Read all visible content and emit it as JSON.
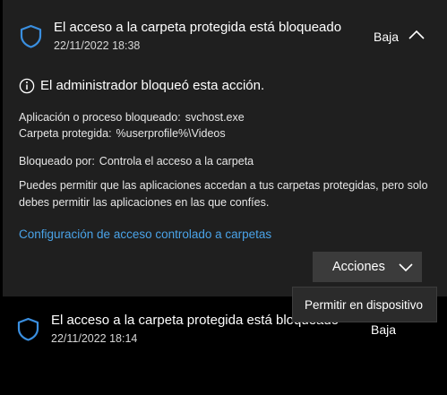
{
  "notification_1": {
    "title": "El acceso a la carpeta protegida está bloqueado",
    "timestamp": "22/11/2022 18:38",
    "severity": "Baja",
    "info_message": "El administrador bloqueó esta acción.",
    "details": {
      "app_label": "Aplicación o proceso bloqueado:",
      "app_value": "svchost.exe",
      "folder_label": "Carpeta protegida:",
      "folder_value": "%userprofile%\\Videos",
      "blocked_by_label": "Bloqueado por:",
      "blocked_by_value": "Controla el acceso a la carpeta"
    },
    "description": "Puedes permitir que las aplicaciones accedan a tus carpetas protegidas, pero solo debes permitir las aplicaciones en las que confíes.",
    "link": "Configuración de acceso controlado a carpetas",
    "actions_button": "Acciones",
    "actions_menu": [
      "Permitir en dispositivo"
    ]
  },
  "notification_2": {
    "title": "El acceso a la carpeta protegida está bloqueado",
    "timestamp": "22/11/2022 18:14",
    "severity": "Baja"
  },
  "colors": {
    "background": "#000000",
    "card": "#1f1f1f",
    "accent": "#4aa3e8",
    "button": "#3b3b3b"
  },
  "icons": [
    "shield-icon",
    "chevron-up-icon",
    "info-icon",
    "chevron-down-icon"
  ]
}
